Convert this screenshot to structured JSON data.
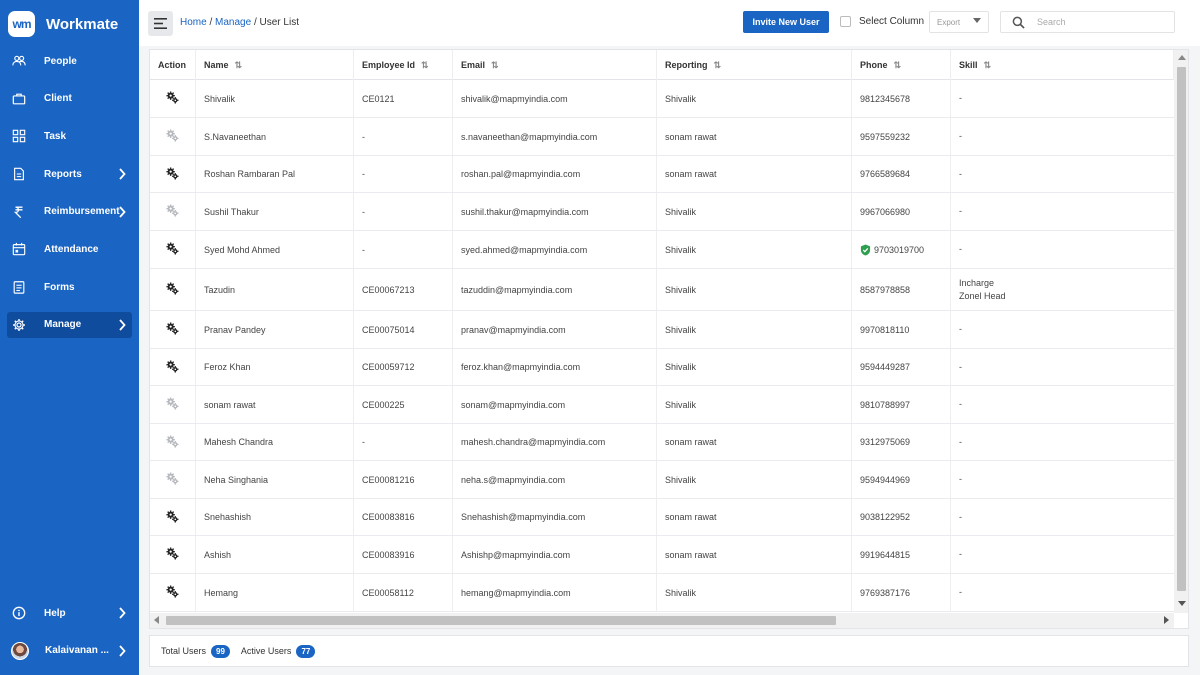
{
  "brand": {
    "logo_text": "wm",
    "name": "Workmate"
  },
  "sidebar": {
    "items": [
      {
        "key": "people",
        "label": "People",
        "icon": "people-icon",
        "chevron": false,
        "active": false
      },
      {
        "key": "client",
        "label": "Client",
        "icon": "briefcase-icon",
        "chevron": false,
        "active": false
      },
      {
        "key": "task",
        "label": "Task",
        "icon": "task-grid-icon",
        "chevron": false,
        "active": false
      },
      {
        "key": "reports",
        "label": "Reports",
        "icon": "document-icon",
        "chevron": true,
        "active": false
      },
      {
        "key": "reimbursement",
        "label": "Reimbursement",
        "icon": "rupee-icon",
        "chevron": true,
        "active": false
      },
      {
        "key": "attendance",
        "label": "Attendance",
        "icon": "calendar-icon",
        "chevron": false,
        "active": false
      },
      {
        "key": "forms",
        "label": "Forms",
        "icon": "form-icon",
        "chevron": false,
        "active": false
      },
      {
        "key": "manage",
        "label": "Manage",
        "icon": "gear-icon",
        "chevron": true,
        "active": true
      }
    ],
    "help_label": "Help",
    "user_label": "Kalaivanan ..."
  },
  "header": {
    "breadcrumb": {
      "home": "Home",
      "manage": "Manage",
      "current": "User List",
      "sep": " / "
    },
    "invite_label": "Invite New User",
    "select_column_label": "Select Column",
    "export_label": "Export",
    "search_placeholder": "Search"
  },
  "table": {
    "columns": [
      "Action",
      "Name",
      "Employee Id",
      "Email",
      "Reporting",
      "Phone",
      "Skill"
    ],
    "sort_glyph": "⇅",
    "rows": [
      {
        "active": true,
        "name": "Shivalik",
        "emp_id": "CE0121",
        "email": "shivalik@mapmyindia.com",
        "reporting": "Shivalik",
        "phone": "9812345678",
        "verified": false,
        "skill": [
          "-"
        ],
        "h": 38
      },
      {
        "active": false,
        "name": "S.Navaneethan",
        "emp_id": "-",
        "email": "s.navaneethan@mapmyindia.com",
        "reporting": "sonam rawat",
        "phone": "9597559232",
        "verified": false,
        "skill": [
          "-"
        ],
        "h": 38
      },
      {
        "active": true,
        "name": "Roshan Rambaran Pal",
        "emp_id": "-",
        "email": "roshan.pal@mapmyindia.com",
        "reporting": "sonam rawat",
        "phone": "9766589684",
        "verified": false,
        "skill": [
          "-"
        ],
        "h": 37
      },
      {
        "active": false,
        "name": "Sushil Thakur",
        "emp_id": "-",
        "email": "sushil.thakur@mapmyindia.com",
        "reporting": "Shivalik",
        "phone": "9967066980",
        "verified": false,
        "skill": [
          "-"
        ],
        "h": 38
      },
      {
        "active": true,
        "name": "Syed Mohd Ahmed",
        "emp_id": "-",
        "email": "syed.ahmed@mapmyindia.com",
        "reporting": "Shivalik",
        "phone": "9703019700",
        "verified": true,
        "skill": [
          "-"
        ],
        "h": 38
      },
      {
        "active": true,
        "name": "Tazudin",
        "emp_id": "CE00067213",
        "email": "tazuddin@mapmyindia.com",
        "reporting": "Shivalik",
        "phone": "8587978858",
        "verified": false,
        "skill": [
          "Incharge",
          "Zonel Head"
        ],
        "h": 42
      },
      {
        "active": true,
        "name": "Pranav Pandey",
        "emp_id": "CE00075014",
        "email": "pranav@mapmyindia.com",
        "reporting": "Shivalik",
        "phone": "9970818110",
        "verified": false,
        "skill": [
          "-"
        ],
        "h": 38
      },
      {
        "active": true,
        "name": "Feroz Khan",
        "emp_id": "CE00059712",
        "email": "feroz.khan@mapmyindia.com",
        "reporting": "Shivalik",
        "phone": "9594449287",
        "verified": false,
        "skill": [
          "-"
        ],
        "h": 37
      },
      {
        "active": false,
        "name": "sonam rawat",
        "emp_id": "CE000225",
        "email": "sonam@mapmyindia.com",
        "reporting": "Shivalik",
        "phone": "9810788997",
        "verified": false,
        "skill": [
          "-"
        ],
        "h": 38
      },
      {
        "active": false,
        "name": "Mahesh Chandra",
        "emp_id": "-",
        "email": "mahesh.chandra@mapmyindia.com",
        "reporting": "sonam rawat",
        "phone": "9312975069",
        "verified": false,
        "skill": [
          "-"
        ],
        "h": 37
      },
      {
        "active": false,
        "name": "Neha Singhania",
        "emp_id": "CE00081216",
        "email": "neha.s@mapmyindia.com",
        "reporting": "Shivalik",
        "phone": "9594944969",
        "verified": false,
        "skill": [
          "-"
        ],
        "h": 38
      },
      {
        "active": true,
        "name": "Snehashish",
        "emp_id": "CE00083816",
        "email": "Snehashish@mapmyindia.com",
        "reporting": "sonam rawat",
        "phone": "9038122952",
        "verified": false,
        "skill": [
          "-"
        ],
        "h": 37
      },
      {
        "active": true,
        "name": "Ashish",
        "emp_id": "CE00083916",
        "email": "Ashishp@mapmyindia.com",
        "reporting": "sonam rawat",
        "phone": "9919644815",
        "verified": false,
        "skill": [
          "-"
        ],
        "h": 38
      },
      {
        "active": true,
        "name": "Hemang",
        "emp_id": "CE00058112",
        "email": "hemang@mapmyindia.com",
        "reporting": "Shivalik",
        "phone": "9769387176",
        "verified": false,
        "skill": [
          "-"
        ],
        "h": 38
      }
    ]
  },
  "footer": {
    "total_label": "Total Users",
    "total_count": "99",
    "active_label": "Active Users",
    "active_count": "77"
  },
  "colors": {
    "primary": "#1a64c3",
    "sidebar_active": "#0f4c9e",
    "gear_active": "#222222",
    "gear_inactive": "#b5b8bd",
    "verified": "#2e9e4f"
  }
}
